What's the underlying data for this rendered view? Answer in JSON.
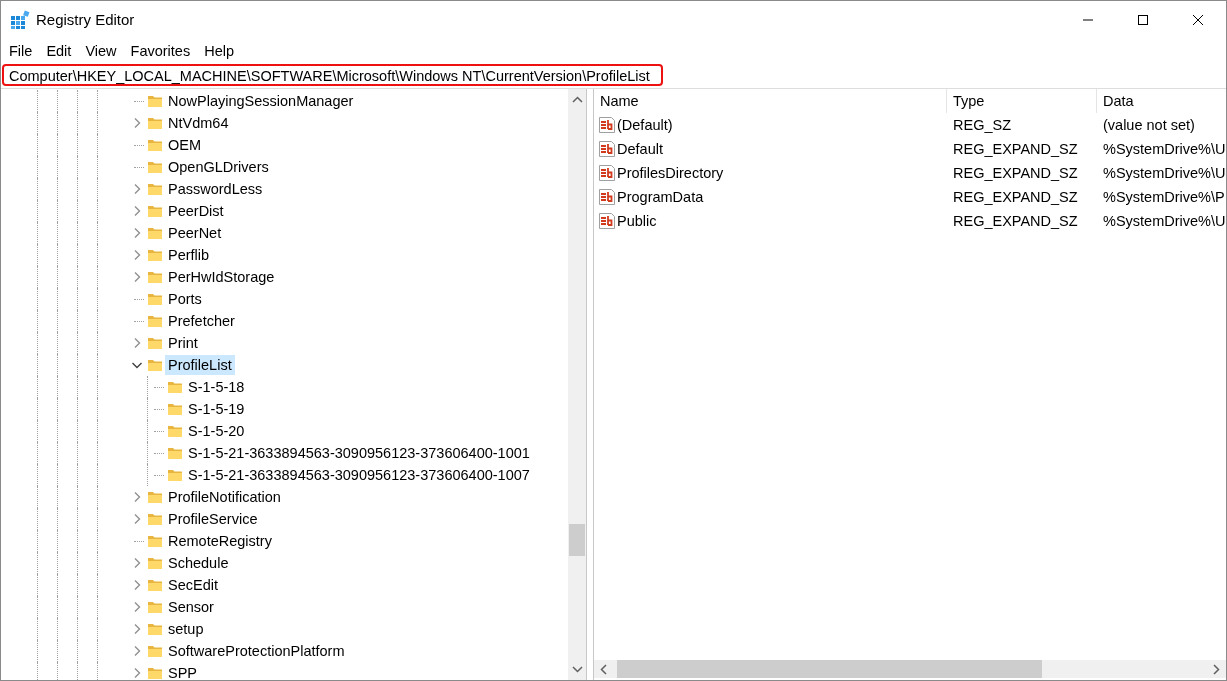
{
  "window": {
    "title": "Registry Editor"
  },
  "menu": [
    "File",
    "Edit",
    "View",
    "Favorites",
    "Help"
  ],
  "address_bar": {
    "value": "Computer\\HKEY_LOCAL_MACHINE\\SOFTWARE\\Microsoft\\Windows NT\\CurrentVersion\\ProfileList",
    "highlighted": true
  },
  "tree": [
    {
      "label": "NowPlayingSessionManager",
      "kind": "leaf",
      "selected": false
    },
    {
      "label": "NtVdm64",
      "kind": "branch",
      "expanded": false,
      "selected": false
    },
    {
      "label": "OEM",
      "kind": "leaf",
      "selected": false
    },
    {
      "label": "OpenGLDrivers",
      "kind": "leaf",
      "selected": false
    },
    {
      "label": "PasswordLess",
      "kind": "branch",
      "expanded": false,
      "selected": false
    },
    {
      "label": "PeerDist",
      "kind": "branch",
      "expanded": false,
      "selected": false
    },
    {
      "label": "PeerNet",
      "kind": "branch",
      "expanded": false,
      "selected": false
    },
    {
      "label": "Perflib",
      "kind": "branch",
      "expanded": false,
      "selected": false
    },
    {
      "label": "PerHwIdStorage",
      "kind": "branch",
      "expanded": false,
      "selected": false
    },
    {
      "label": "Ports",
      "kind": "leaf",
      "selected": false
    },
    {
      "label": "Prefetcher",
      "kind": "leaf",
      "selected": false
    },
    {
      "label": "Print",
      "kind": "branch",
      "expanded": false,
      "selected": false
    },
    {
      "label": "ProfileList",
      "kind": "branch",
      "expanded": true,
      "selected": true,
      "children": [
        {
          "label": "S-1-5-18",
          "kind": "leaf",
          "selected": false
        },
        {
          "label": "S-1-5-19",
          "kind": "leaf",
          "selected": false
        },
        {
          "label": "S-1-5-20",
          "kind": "leaf",
          "selected": false
        },
        {
          "label": "S-1-5-21-3633894563-3090956123-373606400-1001",
          "kind": "leaf",
          "selected": false
        },
        {
          "label": "S-1-5-21-3633894563-3090956123-373606400-1007",
          "kind": "leaf",
          "selected": false
        }
      ]
    },
    {
      "label": "ProfileNotification",
      "kind": "branch",
      "expanded": false,
      "selected": false
    },
    {
      "label": "ProfileService",
      "kind": "branch",
      "expanded": false,
      "selected": false
    },
    {
      "label": "RemoteRegistry",
      "kind": "leaf",
      "selected": false
    },
    {
      "label": "Schedule",
      "kind": "branch",
      "expanded": false,
      "selected": false
    },
    {
      "label": "SecEdit",
      "kind": "branch",
      "expanded": false,
      "selected": false
    },
    {
      "label": "Sensor",
      "kind": "branch",
      "expanded": false,
      "selected": false
    },
    {
      "label": "setup",
      "kind": "branch",
      "expanded": false,
      "selected": false
    },
    {
      "label": "SoftwareProtectionPlatform",
      "kind": "branch",
      "expanded": false,
      "selected": false
    },
    {
      "label": "SPP",
      "kind": "branch",
      "expanded": false,
      "selected": false
    }
  ],
  "values": {
    "columns": [
      "Name",
      "Type",
      "Data"
    ],
    "rows": [
      {
        "name": "(Default)",
        "type": "REG_SZ",
        "data": "(value not set)"
      },
      {
        "name": "Default",
        "type": "REG_EXPAND_SZ",
        "data": "%SystemDrive%\\U"
      },
      {
        "name": "ProfilesDirectory",
        "type": "REG_EXPAND_SZ",
        "data": "%SystemDrive%\\U"
      },
      {
        "name": "ProgramData",
        "type": "REG_EXPAND_SZ",
        "data": "%SystemDrive%\\P"
      },
      {
        "name": "Public",
        "type": "REG_EXPAND_SZ",
        "data": "%SystemDrive%\\U"
      }
    ]
  }
}
